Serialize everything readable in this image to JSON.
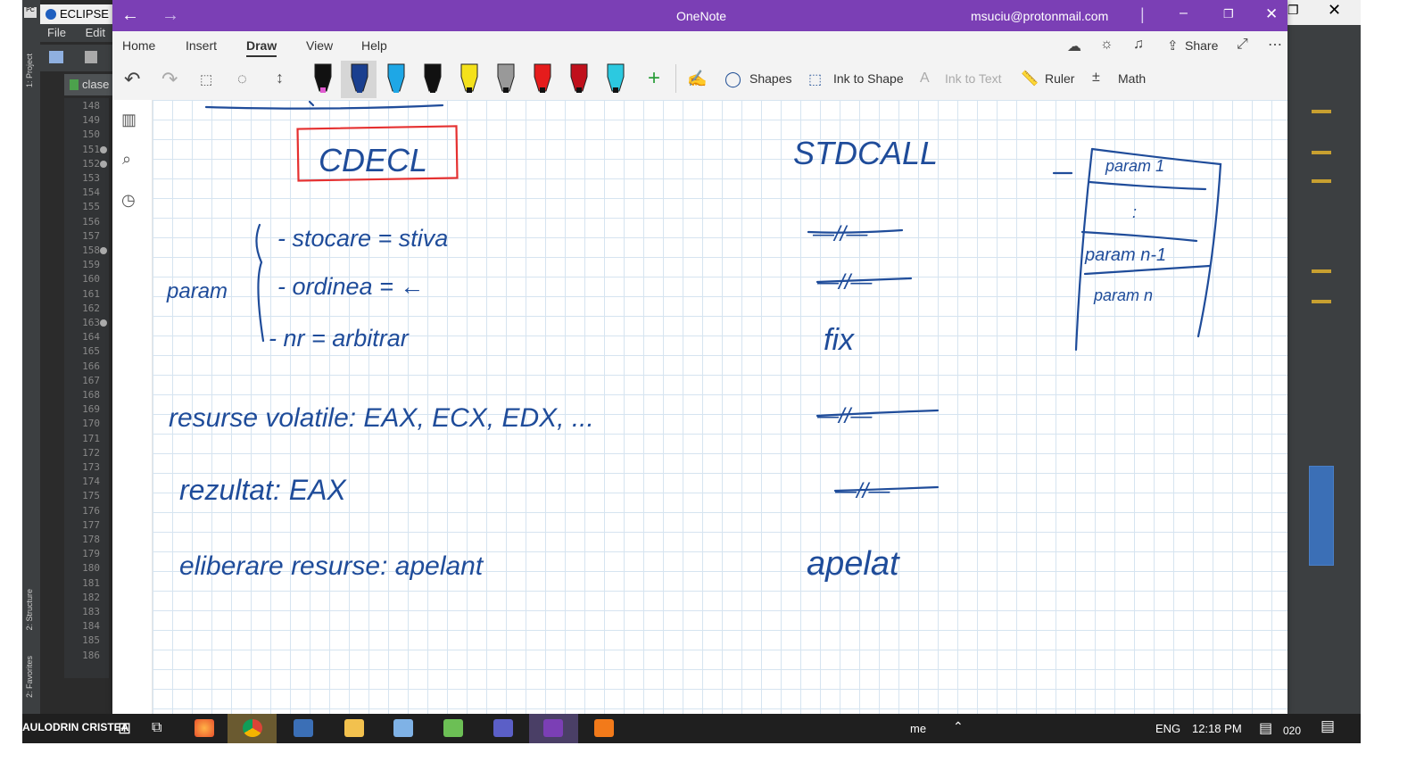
{
  "eclipse": {
    "title": "ECLIPSE P",
    "menu": [
      "File",
      "Edit"
    ],
    "tab_label": "clase",
    "side_labels": [
      "1: Project",
      "2: Structure",
      "2: Favorites"
    ],
    "line_numbers": [
      "148",
      "149",
      "150",
      "151",
      "152",
      "153",
      "154",
      "155",
      "156",
      "157",
      "158",
      "159",
      "160",
      "161",
      "162",
      "163",
      "164",
      "165",
      "166",
      "167",
      "168",
      "169",
      "170",
      "171",
      "172",
      "173",
      "174",
      "175",
      "176",
      "177",
      "178",
      "179",
      "180",
      "181",
      "182",
      "183",
      "184",
      "185",
      "186"
    ],
    "folded_lines": [
      "151",
      "152",
      "158",
      "163"
    ]
  },
  "onenote": {
    "back_icon": "back-arrow-icon",
    "forward_icon": "forward-arrow-icon",
    "app_title": "OneNote",
    "account": "msuciu@protonmail.com",
    "tabs": [
      "Home",
      "Insert",
      "Draw",
      "View",
      "Help"
    ],
    "active_tab": "Draw",
    "share_label": "Share",
    "ribbon": {
      "shapes_label": "Shapes",
      "ink_to_shape_label": "Ink to Shape",
      "ink_to_text_label": "Ink to Text",
      "ruler_label": "Ruler",
      "math_label": "Math"
    },
    "pens": [
      {
        "color": "#111111",
        "tip": "#e05ad0"
      },
      {
        "color": "#1a3f8f",
        "tip": "#1a3f8f"
      },
      {
        "color": "#1ea7e6",
        "tip": "#1ea7e6"
      },
      {
        "color": "#111111",
        "tip": "#111111"
      },
      {
        "color": "#f4e11b",
        "tip": "#111111"
      },
      {
        "color": "#999999",
        "tip": "#111111"
      },
      {
        "color": "#e51c1c",
        "tip": "#111111"
      },
      {
        "color": "#c0101c",
        "tip": "#111111"
      },
      {
        "color": "#2cc9e0",
        "tip": "#111111"
      }
    ],
    "ink": {
      "heading_left": "CDECL",
      "heading_right": "STDCALL",
      "param_label": "param",
      "row1_left": "- stocare = stiva",
      "row2_left": "- ordinea = ←",
      "row3_left": "- nr = arbitrar",
      "row1_right": "—//—",
      "row2_right": "—//—",
      "row3_right": "fix",
      "volatile_left": "resurse volatile: EAX, ECX, EDX, ...",
      "volatile_right": "—//—",
      "result_left": "rezultat: EAX",
      "result_right": "—//—",
      "release_left": "eliberare resurse: apelant",
      "release_right": "apelat",
      "stack": [
        "param 1",
        ":",
        "param n-1",
        "param n"
      ]
    }
  },
  "taskbar": {
    "user_label": "AULODRIN CRISTEA",
    "apps": [
      "firefox-icon",
      "chrome-icon",
      "save-icon",
      "files-icon",
      "paint-icon",
      "notepad-icon",
      "teams-icon",
      "onenote-icon",
      "sublime-icon"
    ],
    "tray_text": "me",
    "language": "ENG",
    "time": "12:18 PM",
    "date_fragment": "020"
  }
}
